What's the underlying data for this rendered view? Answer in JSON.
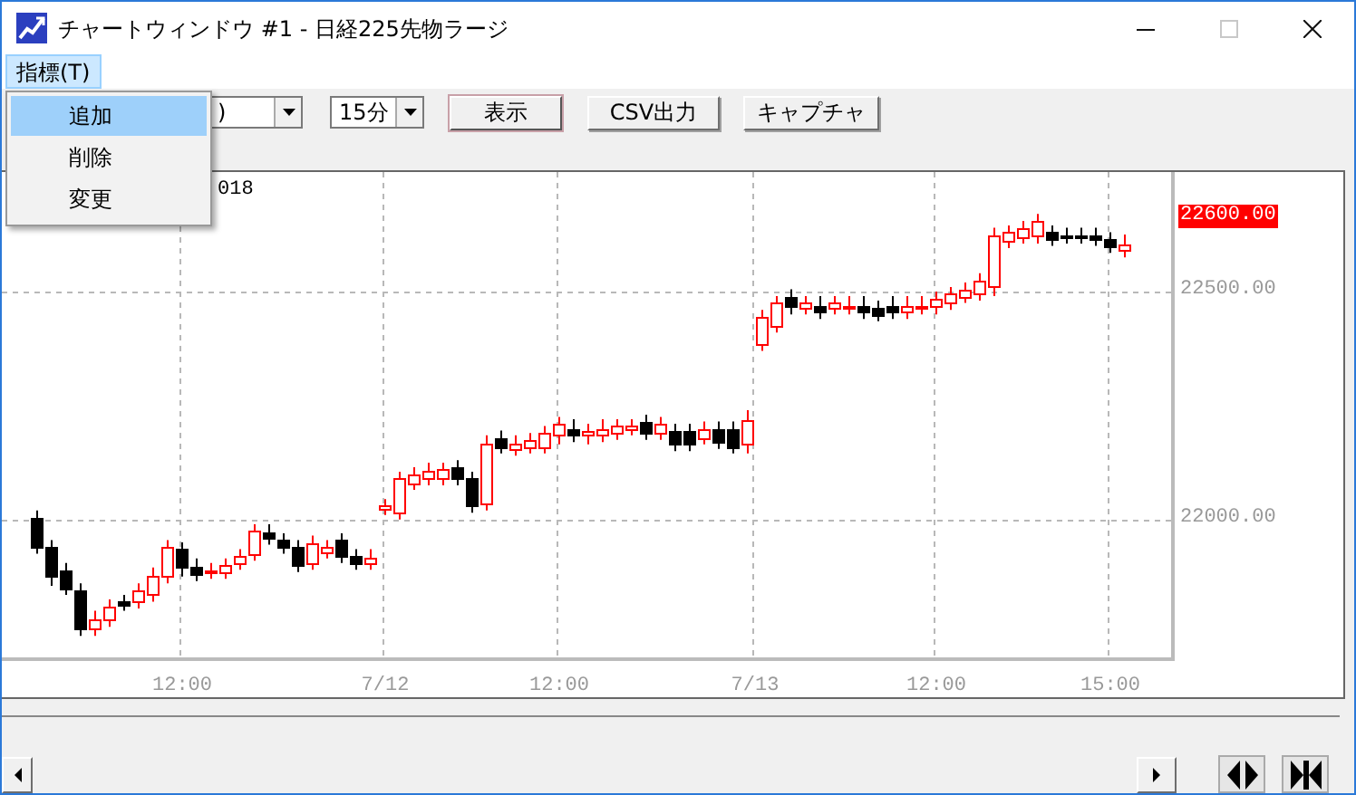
{
  "window": {
    "title": "チャートウィンドウ #1 - 日経225先物ラージ",
    "controls": [
      {
        "kind": "minimize",
        "disabled": false
      },
      {
        "kind": "maximize",
        "disabled": true
      },
      {
        "kind": "close",
        "disabled": false
      }
    ]
  },
  "menu_bar": [
    {
      "label": "指標(T)",
      "expanded": true
    }
  ],
  "menu_popup": {
    "items": [
      {
        "label": "追加",
        "selected": true
      },
      {
        "label": "削除",
        "selected": false
      },
      {
        "label": "変更",
        "selected": false
      }
    ]
  },
  "toolbar": {
    "symbol_select": {
      "value": ")"
    },
    "interval_select": {
      "value": "15分"
    },
    "buttons": [
      {
        "label": "表示",
        "default": true
      },
      {
        "label": "CSV出力",
        "default": false
      },
      {
        "label": "キャプチャ",
        "default": false
      }
    ]
  },
  "chart": {
    "header_text": "018",
    "price_labels": [
      {
        "text": "22600.00",
        "kind": "current"
      }
    ],
    "time_labels": [
      "12:00",
      "7/12",
      "12:00",
      "7/13",
      "12:00",
      "15:00"
    ],
    "chart_data": {
      "type": "candlestick",
      "grid": true,
      "ylim": [
        21690,
        22762
      ],
      "ohlc": [
        [
          22005,
          22020,
          21925,
          21940
        ],
        [
          21940,
          21955,
          21855,
          21875
        ],
        [
          21890,
          21905,
          21835,
          21850
        ],
        [
          21845,
          21860,
          21745,
          21760
        ],
        [
          21760,
          21800,
          21745,
          21780
        ],
        [
          21780,
          21825,
          21765,
          21810
        ],
        [
          21820,
          21835,
          21800,
          21815
        ],
        [
          21820,
          21860,
          21805,
          21845
        ],
        [
          21835,
          21895,
          21820,
          21875
        ],
        [
          21875,
          21955,
          21860,
          21940
        ],
        [
          21935,
          21950,
          21875,
          21895
        ],
        [
          21895,
          21915,
          21865,
          21880
        ],
        [
          21885,
          21905,
          21870,
          21890
        ],
        [
          21885,
          21915,
          21870,
          21900
        ],
        [
          21905,
          21935,
          21890,
          21920
        ],
        [
          21925,
          21990,
          21910,
          21975
        ],
        [
          21970,
          21990,
          21945,
          21960
        ],
        [
          21955,
          21970,
          21925,
          21940
        ],
        [
          21940,
          21955,
          21885,
          21900
        ],
        [
          21905,
          21965,
          21890,
          21950
        ],
        [
          21930,
          21955,
          21915,
          21940
        ],
        [
          21955,
          21970,
          21905,
          21920
        ],
        [
          21920,
          21935,
          21890,
          21905
        ],
        [
          21905,
          21935,
          21890,
          21915
        ],
        [
          22025,
          22045,
          22010,
          22030
        ],
        [
          22015,
          22105,
          22000,
          22090
        ],
        [
          22080,
          22115,
          22065,
          22100
        ],
        [
          22090,
          22125,
          22075,
          22105
        ],
        [
          22090,
          22125,
          22075,
          22110
        ],
        [
          22115,
          22130,
          22075,
          22090
        ],
        [
          22090,
          22105,
          22015,
          22030
        ],
        [
          22035,
          22185,
          22020,
          22165
        ],
        [
          22180,
          22195,
          22145,
          22160
        ],
        [
          22155,
          22185,
          22140,
          22165
        ],
        [
          22160,
          22190,
          22145,
          22175
        ],
        [
          22160,
          22205,
          22145,
          22190
        ],
        [
          22185,
          22225,
          22165,
          22210
        ],
        [
          22200,
          22220,
          22170,
          22185
        ],
        [
          22185,
          22210,
          22165,
          22195
        ],
        [
          22185,
          22220,
          22170,
          22200
        ],
        [
          22190,
          22220,
          22175,
          22205
        ],
        [
          22200,
          22220,
          22185,
          22205
        ],
        [
          22215,
          22230,
          22175,
          22190
        ],
        [
          22190,
          22225,
          22175,
          22210
        ],
        [
          22195,
          22210,
          22150,
          22165
        ],
        [
          22195,
          22210,
          22150,
          22165
        ],
        [
          22180,
          22215,
          22165,
          22200
        ],
        [
          22200,
          22215,
          22155,
          22170
        ],
        [
          22200,
          22215,
          22145,
          22160
        ],
        [
          22165,
          22240,
          22145,
          22220
        ],
        [
          22385,
          22460,
          22370,
          22445
        ],
        [
          22425,
          22490,
          22410,
          22475
        ],
        [
          22490,
          22505,
          22450,
          22470
        ],
        [
          22465,
          22490,
          22450,
          22475
        ],
        [
          22470,
          22490,
          22440,
          22455
        ],
        [
          22465,
          22490,
          22450,
          22475
        ],
        [
          22465,
          22490,
          22450,
          22470
        ],
        [
          22470,
          22490,
          22440,
          22455
        ],
        [
          22465,
          22480,
          22435,
          22450
        ],
        [
          22470,
          22490,
          22440,
          22455
        ],
        [
          22455,
          22490,
          22440,
          22470
        ],
        [
          22465,
          22490,
          22450,
          22470
        ],
        [
          22470,
          22500,
          22450,
          22485
        ],
        [
          22475,
          22510,
          22460,
          22495
        ],
        [
          22490,
          22520,
          22475,
          22505
        ],
        [
          22495,
          22540,
          22480,
          22525
        ],
        [
          22510,
          22640,
          22490,
          22625
        ],
        [
          22610,
          22645,
          22595,
          22630
        ],
        [
          22620,
          22655,
          22605,
          22640
        ],
        [
          22625,
          22670,
          22605,
          22655
        ],
        [
          22630,
          22645,
          22600,
          22615
        ],
        [
          22625,
          22640,
          22605,
          22620
        ],
        [
          22625,
          22640,
          22605,
          22620
        ],
        [
          22625,
          22640,
          22600,
          22615
        ],
        [
          22615,
          22630,
          22585,
          22600
        ],
        [
          22590,
          22625,
          22575,
          22605
        ]
      ],
      "yticks": [
        {
          "value": 22500,
          "label": "22500.00"
        },
        {
          "value": 22000,
          "label": "22000.00"
        }
      ]
    }
  }
}
